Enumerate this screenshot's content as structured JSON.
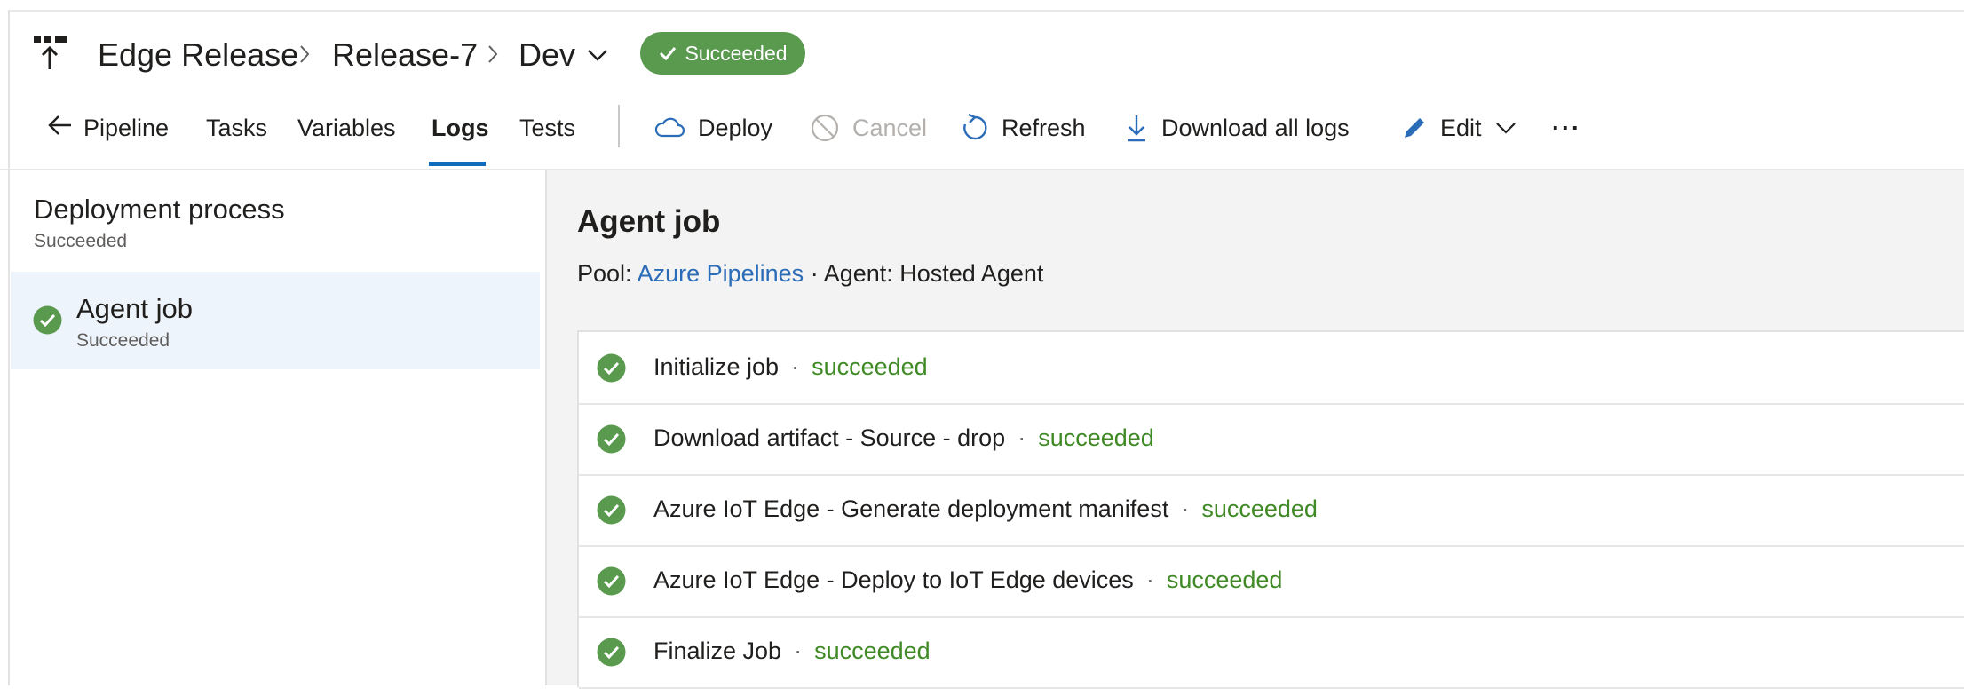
{
  "breadcrumb": {
    "pipeline": "Edge Release",
    "release": "Release-7",
    "stage": "Dev"
  },
  "status_pill": {
    "label": "Succeeded",
    "color": "#5a9a4f"
  },
  "tabs": {
    "pipeline": "Pipeline",
    "tasks": "Tasks",
    "variables": "Variables",
    "logs": "Logs",
    "tests": "Tests"
  },
  "toolbar": {
    "deploy": "Deploy",
    "cancel": "Cancel",
    "refresh": "Refresh",
    "download_logs": "Download all logs",
    "edit": "Edit",
    "more": "···"
  },
  "left_pane": {
    "process_title": "Deployment process",
    "process_status": "Succeeded",
    "job_title": "Agent job",
    "job_status": "Succeeded"
  },
  "job": {
    "title": "Agent job",
    "pool_label": "Pool:",
    "pool_value": "Azure Pipelines",
    "agent_text": "· Agent: Hosted Agent"
  },
  "steps": [
    {
      "name": "Initialize job",
      "status": "succeeded"
    },
    {
      "name": "Download artifact - Source - drop",
      "status": "succeeded"
    },
    {
      "name": "Azure IoT Edge - Generate deployment manifest",
      "status": "succeeded"
    },
    {
      "name": "Azure IoT Edge - Deploy to IoT Edge devices",
      "status": "succeeded"
    },
    {
      "name": "Finalize Job",
      "status": "succeeded"
    }
  ],
  "colors": {
    "success": "#5a9a4f",
    "accent": "#0f6cbd",
    "link": "#2b6cb8"
  }
}
